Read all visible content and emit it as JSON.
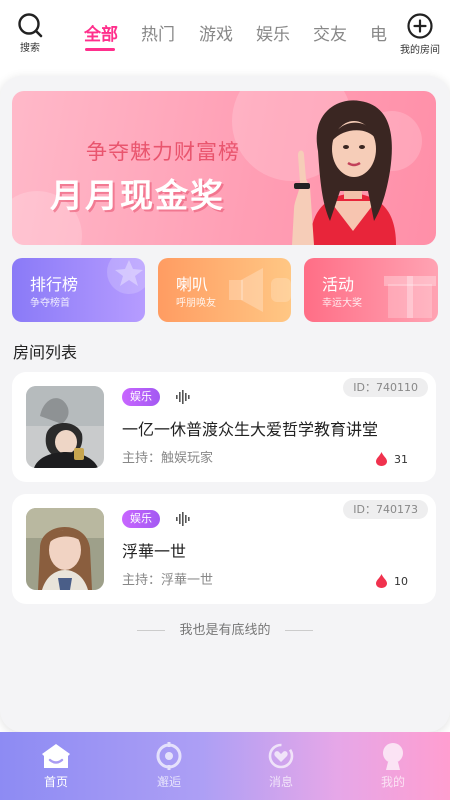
{
  "topbar": {
    "search_label": "搜索",
    "my_room_label": "我的房间",
    "tabs": [
      {
        "label": "全部",
        "active": true
      },
      {
        "label": "热门",
        "active": false
      },
      {
        "label": "游戏",
        "active": false
      },
      {
        "label": "娱乐",
        "active": false
      },
      {
        "label": "交友",
        "active": false
      },
      {
        "label": "电",
        "active": false
      }
    ]
  },
  "banner": {
    "line1": "争夺魅力财富榜",
    "line2": "月月现金奖"
  },
  "quick_links": [
    {
      "title": "排行榜",
      "subtitle": "争夺榜首"
    },
    {
      "title": "喇叭",
      "subtitle": "呼朋唤友"
    },
    {
      "title": "活动",
      "subtitle": "幸运大奖"
    }
  ],
  "section_title": "房间列表",
  "rooms": [
    {
      "tag": "娱乐",
      "id": "ID：740110",
      "name": "一亿一休普渡众生大爱哲学教育讲堂",
      "host": "主持：触娱玩家",
      "heat": "31"
    },
    {
      "tag": "娱乐",
      "id": "ID：740173",
      "name": "浮華一世",
      "host": "主持：浮華一世",
      "heat": "10"
    }
  ],
  "footer_note": "我也是有底线的",
  "bottom_nav": [
    {
      "label": "首页",
      "active": true
    },
    {
      "label": "邂逅",
      "active": false
    },
    {
      "label": "消息",
      "active": false
    },
    {
      "label": "我的",
      "active": false
    }
  ],
  "colors": {
    "accent": "#ff2f8c",
    "panel_bg": "#f4f4f6",
    "tag_purple": "#b35ff6",
    "heat_red": "#f0324e"
  },
  "icons": {
    "search": "search-icon",
    "my_room": "plus-circle-icon",
    "heat": "flame-drop-icon",
    "voice": "sound-wave-icon",
    "nav_home": "home-icon",
    "nav_meet": "compass-icon",
    "nav_message": "chat-heart-icon",
    "nav_me": "person-icon"
  }
}
